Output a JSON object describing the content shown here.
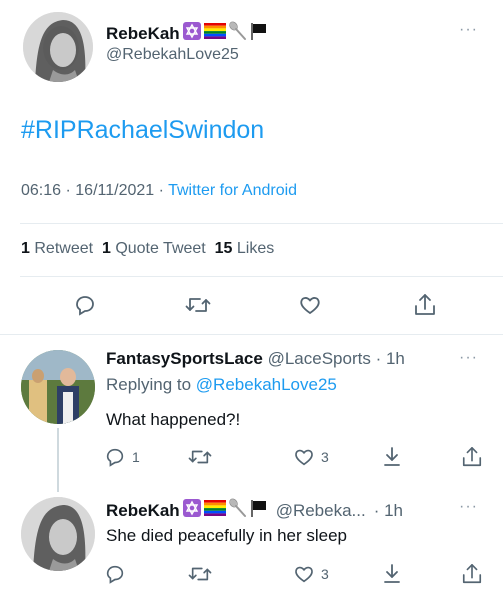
{
  "main_tweet": {
    "author_name": "RebeKah",
    "author_handle": "@RebekahLove25",
    "text": "#RIPRachaelSwindon",
    "time": "06:16",
    "date": "16/11/2021",
    "separator": "·",
    "source": "Twitter for Android",
    "more": "···",
    "stats": {
      "retweets_count": "1",
      "retweets_label": "Retweet",
      "quotes_count": "1",
      "quotes_label": "Quote Tweet",
      "likes_count": "15",
      "likes_label": "Likes"
    }
  },
  "reply_1": {
    "author_name": "FantasySportsLace",
    "author_handle": "@LaceSports",
    "time": "· 1h",
    "replying_prefix": "Replying to",
    "replying_to": "@RebekahLove25",
    "text": "What happened?!",
    "more": "···",
    "reply_count": "1",
    "like_count": "3"
  },
  "reply_2": {
    "author_name": "RebeKah",
    "author_handle": "@Rebeka...",
    "time": "· 1h",
    "text": "She died peacefully in her sleep",
    "more": "···",
    "like_count": "3"
  },
  "colors": {
    "accent": "#1d9bf0",
    "secondary_text": "#536471",
    "divider": "#e6ecf0",
    "badge_purple": "#9b59d0"
  },
  "icons": {
    "star_of_david": "star-of-david-emoji",
    "rainbow_flag": "rainbow-flag-emoji",
    "spoon": "spoon-emoji",
    "black_flag": "black-flag-emoji"
  }
}
